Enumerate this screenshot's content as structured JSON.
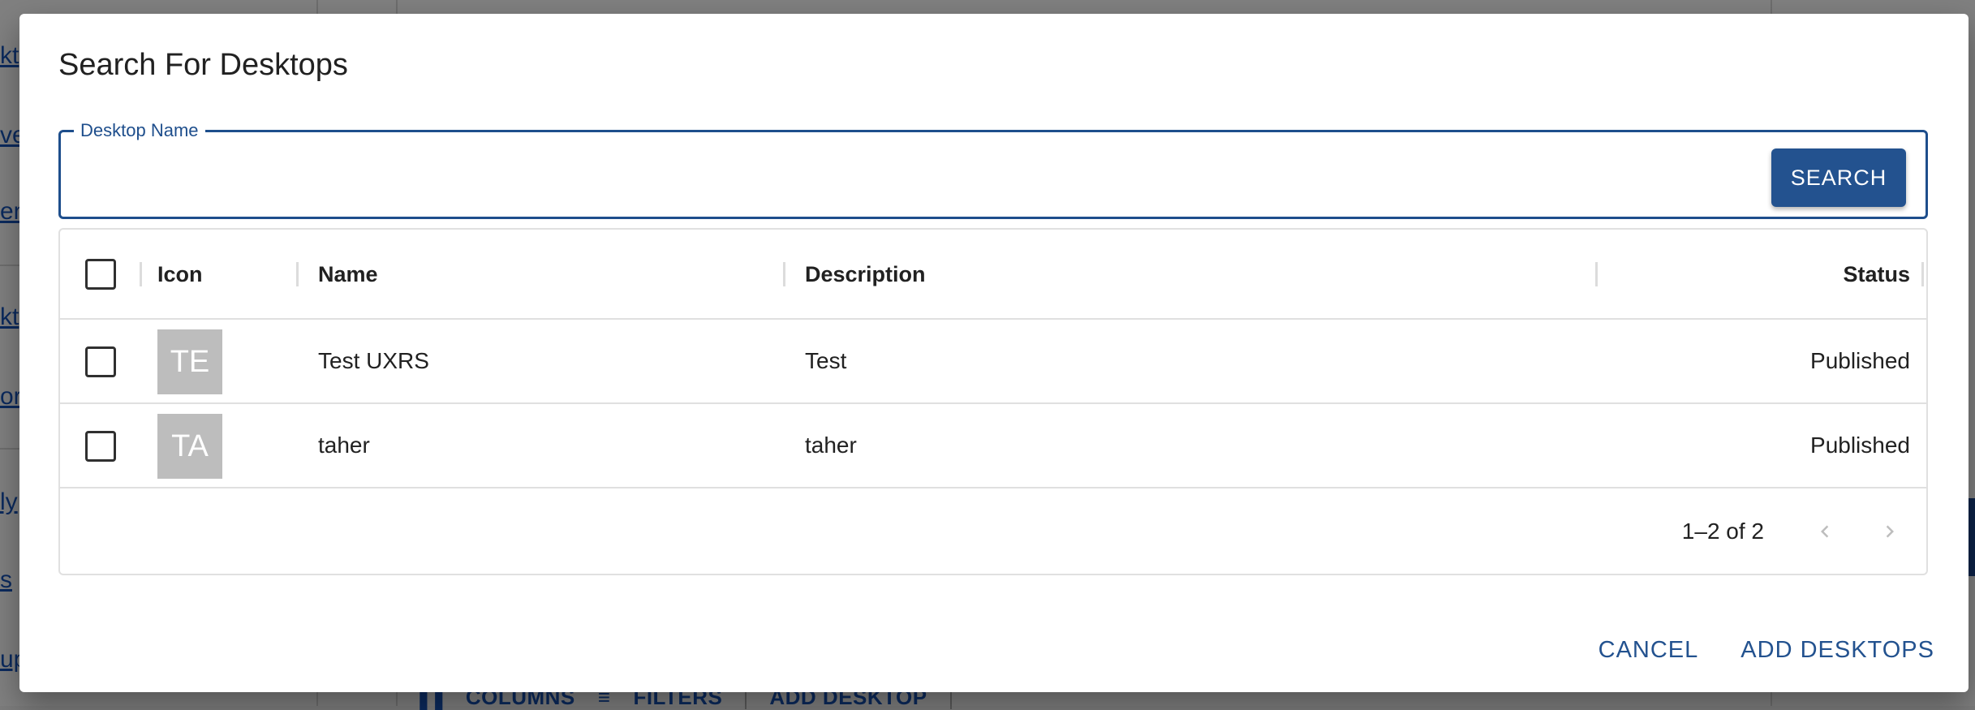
{
  "background": {
    "sidebar_links": [
      "kt",
      "ve",
      "en",
      "kt",
      "or",
      "ly",
      "s",
      "up"
    ],
    "toolbar": {
      "columns": "COLUMNS",
      "filters": "FILTERS",
      "add_desktop": "ADD DESKTOP"
    }
  },
  "dialog": {
    "title": "Search For Desktops",
    "search_field": {
      "label": "Desktop Name",
      "value": "",
      "placeholder": ""
    },
    "search_button": "SEARCH",
    "grid": {
      "columns": {
        "icon": "Icon",
        "name": "Name",
        "description": "Description",
        "status": "Status"
      },
      "rows": [
        {
          "initials": "TE",
          "name": "Test UXRS",
          "description": "Test",
          "status": "Published"
        },
        {
          "initials": "TA",
          "name": "taher",
          "description": "taher",
          "status": "Published"
        }
      ],
      "pagination": "1–2 of 2"
    },
    "actions": {
      "cancel": "CANCEL",
      "add": "ADD DESKTOPS"
    }
  },
  "colors": {
    "primary": "#23528f",
    "avatar_bg": "#bdbdbd",
    "overlay": "#808080"
  },
  "icons": {
    "prev": "chevron-left-icon",
    "next": "chevron-right-icon",
    "columns": "columns-icon",
    "filters": "filter-icon"
  }
}
